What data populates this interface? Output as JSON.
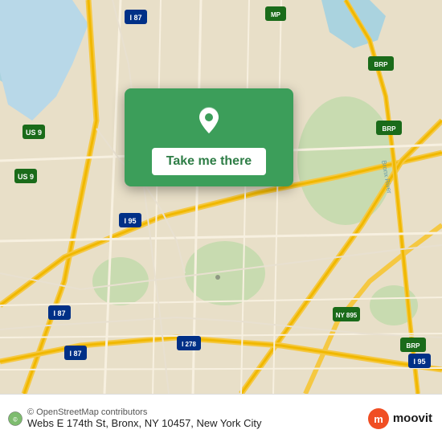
{
  "map": {
    "backgroundColor": "#e8dfc8",
    "waterColor": "#aad3df",
    "greenColor": "#b5d29e",
    "roadColor": "#f7f0e0",
    "highlightRoad": "#f5c842"
  },
  "card": {
    "backgroundColor": "#3c9e5a",
    "buttonLabel": "Take me there",
    "pinIcon": "location-pin-icon"
  },
  "bottomBar": {
    "attribution": "© OpenStreetMap contributors",
    "address": "Webs E 174th St, Bronx, NY 10457, New York City",
    "brandName": "moovit"
  }
}
